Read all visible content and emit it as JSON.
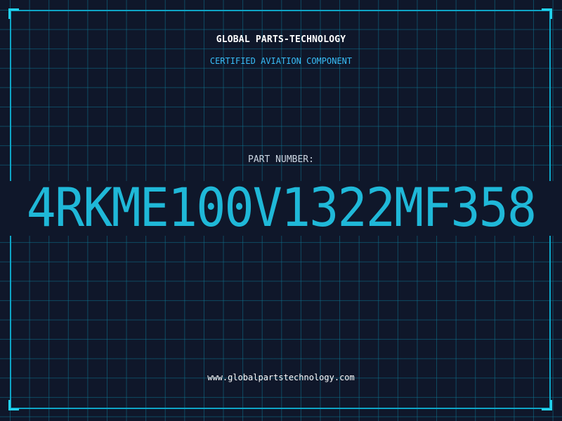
{
  "header": {
    "company": "GLOBAL PARTS-TECHNOLOGY",
    "subtitle": "CERTIFIED AVIATION COMPONENT"
  },
  "part": {
    "label": "PART NUMBER:",
    "number": "4RKME100V1322MF358"
  },
  "footer": {
    "website": "www.globalpartstechnology.com"
  },
  "colors": {
    "background": "#0f172a",
    "accent": "#22d3ee",
    "part_number": "#1fb8d8",
    "grid": "#0e7490"
  }
}
